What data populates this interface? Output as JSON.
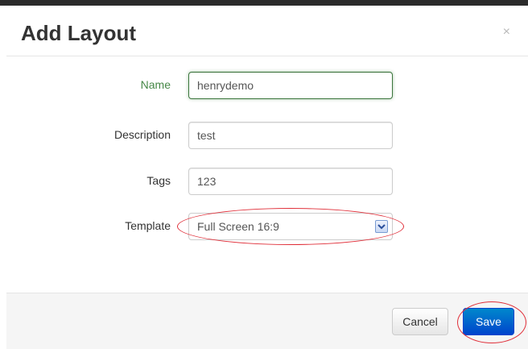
{
  "modal": {
    "title": "Add Layout",
    "close_symbol": "×"
  },
  "form": {
    "name": {
      "label": "Name",
      "value": "henrydemo",
      "state": "success"
    },
    "description": {
      "label": "Description",
      "value": "test"
    },
    "tags": {
      "label": "Tags",
      "value": "123"
    },
    "template": {
      "label": "Template",
      "selected": "Full Screen 16:9"
    }
  },
  "footer": {
    "cancel_label": "Cancel",
    "save_label": "Save"
  },
  "annotations": {
    "color": "#e0303a",
    "highlighted": [
      "template-select",
      "save-button"
    ]
  },
  "colors": {
    "success": "#468847",
    "primary": "#0055cc",
    "topbar": "#2b2b2b"
  },
  "icons": {
    "close": "close-icon",
    "select_arrow": "chevron-down-icon"
  }
}
